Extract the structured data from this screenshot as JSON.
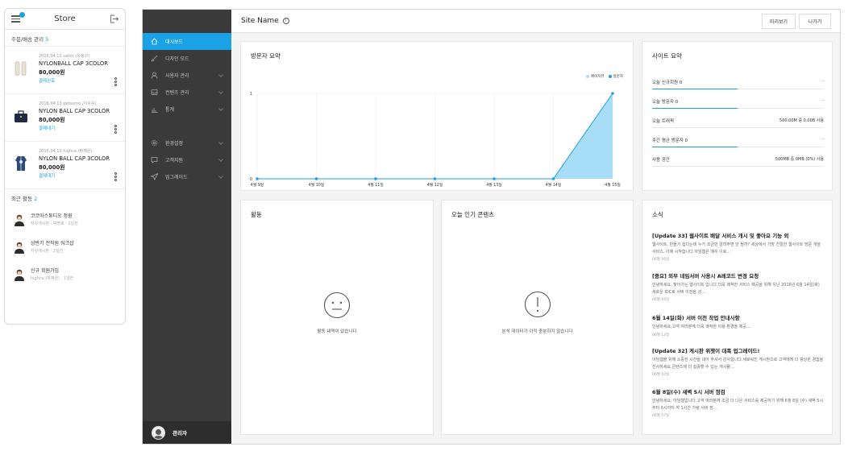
{
  "store": {
    "title": "Store",
    "orders_label": "주문/배송 관리",
    "orders_count": "5",
    "orders": [
      {
        "meta": "2016.04.13   sailor (유정구)",
        "name1": "NYLONBALL CAP 3COLOR",
        "name2": "",
        "price": "80,000원",
        "status": "결제완료",
        "thumb": "shoes-icon"
      },
      {
        "meta": "2016.04.13   getsumo (이수웅)",
        "name1": "NYLON BALL CAP 3COLOR",
        "name2": "",
        "price": "80,000원",
        "status": "결제대기",
        "thumb": "bag-icon"
      },
      {
        "meta": "2016.04.13   highca (박재완)",
        "name1": "NYLON BALL CAP 3COLOR",
        "name2": "",
        "price": "80,000원",
        "status": "결제대기",
        "thumb": "jacket-icon"
      }
    ],
    "activity_label": "최근 활동",
    "activity_count": "2",
    "activities": [
      {
        "title": "코코아스튜디오 정원",
        "sub": "자유게시판 · 박명호 · 1일전"
      },
      {
        "title": "상반기 전직원 워크샵",
        "sub": "자유게시판 · 2일전"
      },
      {
        "title": "신규 회원가입",
        "sub": "highca (박재완) · 1일전"
      }
    ]
  },
  "sidebar": {
    "items": [
      {
        "label": "대시보드",
        "icon": "home-icon",
        "active": true
      },
      {
        "label": "디자인 모드",
        "icon": "brush-icon"
      },
      {
        "label": "사용자 관리",
        "icon": "users-icon"
      },
      {
        "label": "컨텐츠 관리",
        "icon": "inbox-icon"
      },
      {
        "label": "통계",
        "icon": "bar-chart-icon"
      },
      {
        "label": "환경설정",
        "icon": "gear-icon"
      },
      {
        "label": "고객지원",
        "icon": "chat-icon"
      },
      {
        "label": "업그레이드",
        "icon": "send-icon"
      }
    ],
    "user": "관리자"
  },
  "topbar": {
    "site_name": "Site Name",
    "preview": "미리보기",
    "exit": "나가기"
  },
  "visitors": {
    "title": "방문자 요약",
    "legend_pageview": "페이지뷰",
    "legend_visitor": "방문자"
  },
  "chart_data": {
    "type": "area",
    "categories": [
      "4월 9일",
      "4월 10일",
      "4월 11일",
      "4월 12일",
      "4월 13일",
      "4월 14일",
      "4월 15일"
    ],
    "series": [
      {
        "name": "페이지뷰",
        "values": [
          0,
          0,
          0,
          0,
          0,
          0,
          1
        ]
      },
      {
        "name": "방문자",
        "values": [
          0,
          0,
          0,
          0,
          0,
          0,
          1
        ]
      }
    ],
    "ylim": [
      0,
      1
    ],
    "yticks": [
      "0",
      "1"
    ],
    "grid": true,
    "legend": "top-right",
    "colors": {
      "area": "#a8ddf7",
      "line": "#1ba1e6",
      "pageview": "#a8ddf7",
      "visitor": "#1ba1e6"
    }
  },
  "site_summary": {
    "title": "사이트 요약",
    "rows": [
      {
        "label": "오늘 신규회원 0",
        "value": "-",
        "bar": 0.5
      },
      {
        "label": "오늘 방문자 0",
        "value": "-",
        "bar": 0.5
      },
      {
        "label": "오늘 트래픽",
        "value": "500.00M 중 0.00B 사용"
      },
      {
        "label": "주간 평균 방문자 0",
        "value": "-",
        "bar": 0.5
      },
      {
        "label": "사용 공간",
        "value": "500MB 중 0MB (0%) 사용"
      }
    ]
  },
  "activity": {
    "title": "활동",
    "empty": "활동 내역이 없습니다"
  },
  "popular": {
    "title": "오늘 인기 콘텐츠",
    "empty": "분석 데이터가 아직 충분하지 않습니다"
  },
  "news": {
    "title": "소식",
    "items": [
      {
        "title": "[Update 33] 웹사이트 배달 서비스 개시 및 좋아요 기능 외",
        "body": "웹사이트, 만들기 쉽다는데 누가 조금만 알려주면 안 될까? 세상에서 가장 친절한 웹사이트 방문 개설 서비스, 이제 시작합니다.아임웹은 매우 이로...",
        "date": "06월 16일"
      },
      {
        "title": "[중요] 외부 네임서버 사용시 A레코드 변경 요청",
        "body": "안녕하세요, 찾아가는 웹사이트 입니다.더욱 쾌적한 서비스 제공을 위해 지난 2016년 6월 14일(화) 새로운 IDC로 서버 이전을 성...",
        "date": "06월 16일"
      },
      {
        "title": "6월 14일(화) 서버 이전 작업 안내사항",
        "body": "안녕하세요,고객 여러분께 더욱 쾌적한 이용 환경을 제공...",
        "date": "06월 13일"
      },
      {
        "title": "[Update 32] 게시판 위젯이 대폭 업그레이드!",
        "body": "아임웹을 위해 소중한 시간을 내어 주셔서 감사합니다.새로워진 게시판으로 고객에게 더 향상된 경험을 선사하세요.콘텐츠에 더 집중할 수 있는 게시물...",
        "date": "06월 10일"
      },
      {
        "title": "6월 8일(수) 새벽 5시 서버 점검",
        "body": "안녕하세요, 아임웹입니다.고객 여러분께 조금 더 나은 서비스를 제공하기 위해 6월 8일 (수) 새벽 5시 부터 6시까지 약 1시간 가량 서버 점...",
        "date": "06월 07일"
      }
    ]
  }
}
